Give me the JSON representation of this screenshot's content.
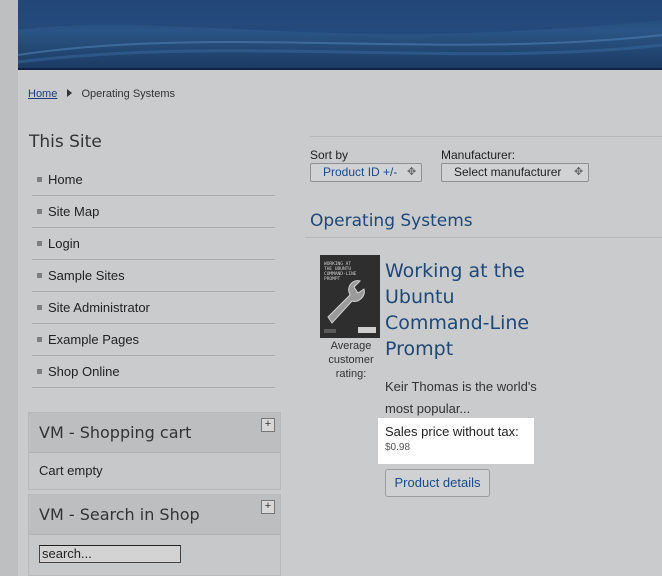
{
  "breadcrumb": {
    "home": "Home",
    "current": "Operating Systems"
  },
  "sidebar": {
    "title": "This Site",
    "items": [
      {
        "label": "Home"
      },
      {
        "label": "Site Map"
      },
      {
        "label": "Login"
      },
      {
        "label": "Sample Sites"
      },
      {
        "label": "Site Administrator"
      },
      {
        "label": "Example Pages"
      },
      {
        "label": "Shop Online"
      }
    ]
  },
  "cart_module": {
    "title": "VM - Shopping cart",
    "toggle": "+",
    "body": "Cart empty"
  },
  "search_module": {
    "title": "VM - Search in Shop",
    "toggle": "+",
    "input_value": "search..."
  },
  "filters": {
    "sort_label": "Sort by",
    "sort_value": "Product ID +/-",
    "manufacturer_label": "Manufacturer:",
    "manufacturer_value": "Select manufacturer",
    "dropdown_arrow": "✥"
  },
  "category": {
    "title": "Operating Systems"
  },
  "product": {
    "title": "Working at the Ubuntu Command-Line Prompt",
    "rating_label": "Average customer rating:",
    "description": "Keir Thomas is the world's most popular...",
    "price_label": "Sales price without tax:",
    "price_value": "$0.98",
    "details_button": "Product details",
    "cover_text": "WORKING AT THE UBUNTU COMMAND-LINE PROMPT"
  },
  "colors": {
    "banner": "#2a5586",
    "link": "#1d4a88",
    "heading": "#1f4777",
    "page_bg": "#c9cbcc"
  }
}
